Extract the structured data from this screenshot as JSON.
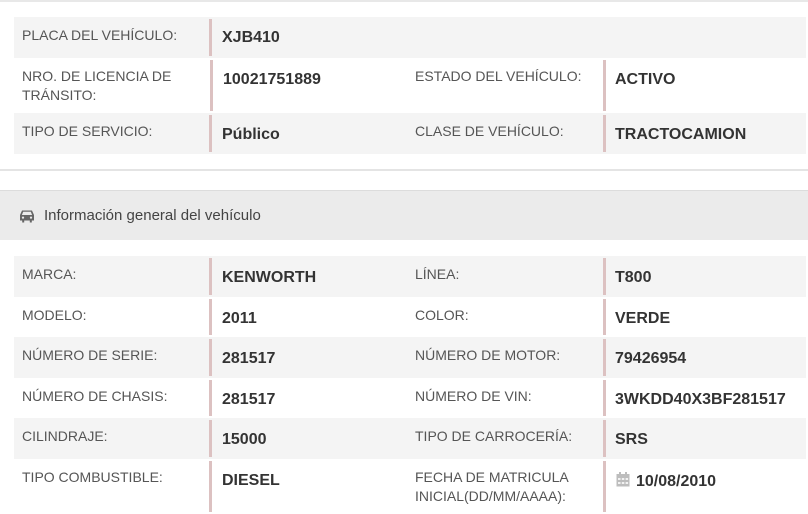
{
  "top_table": {
    "plate_label": "PLACA DEL VEHÍCULO:",
    "plate_value": "XJB410",
    "license_label": "NRO. DE LICENCIA DE TRÁNSITO:",
    "license_value": "10021751889",
    "status_label": "ESTADO DEL VEHÍCULO:",
    "status_value": "ACTIVO",
    "service_label": "TIPO DE SERVICIO:",
    "service_value": "Público",
    "class_label": "CLASE DE VEHÍCULO:",
    "class_value": "TRACTOCAMION"
  },
  "section": {
    "icon": "car-icon",
    "title": "Información general del vehículo"
  },
  "general": {
    "brand_label": "MARCA:",
    "brand_value": "KENWORTH",
    "line_label": "LÍNEA:",
    "line_value": "T800",
    "model_label": "MODELO:",
    "model_value": "2011",
    "color_label": "COLOR:",
    "color_value": "VERDE",
    "serial_label": "NÚMERO DE SERIE:",
    "serial_value": "281517",
    "engine_label": "NÚMERO DE MOTOR:",
    "engine_value": "79426954",
    "chassis_label": "NÚMERO DE CHASIS:",
    "chassis_value": "281517",
    "vin_label": "NÚMERO DE VIN:",
    "vin_value": "3WKDD40X3BF281517",
    "displacement_label": "CILINDRAJE:",
    "displacement_value": "15000",
    "body_label": "TIPO DE CARROCERÍA:",
    "body_value": "SRS",
    "fuel_label": "TIPO COMBUSTIBLE:",
    "fuel_value": "DIESEL",
    "registration_label": "FECHA DE MATRICULA INICIAL(DD/MM/AAAA):",
    "registration_value": "10/08/2010",
    "registration_icon": "calendar-icon"
  },
  "colors": {
    "value_border": "#dcc1c1",
    "shaded_row": "#f4f4f4",
    "header_bg": "#ebebeb"
  }
}
